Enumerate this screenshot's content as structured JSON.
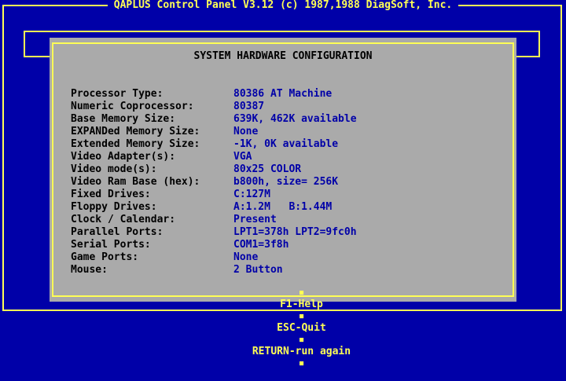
{
  "window": {
    "title": "QAPLUS Control Panel V3.12 (c) 1987,1988 DiagSoft, Inc."
  },
  "dialog": {
    "title": "SYSTEM HARDWARE CONFIGURATION",
    "rows": [
      {
        "label": "Processor Type:",
        "value": "80386 AT Machine"
      },
      {
        "label": "Numeric Coprocessor:",
        "value": "80387"
      },
      {
        "label": "Base Memory Size:",
        "value": "639K, 462K available"
      },
      {
        "label": "EXPANDed Memory Size:",
        "value": "None"
      },
      {
        "label": "Extended Memory Size:",
        "value": "-1K, 0K available"
      },
      {
        "label": "Video Adapter(s):",
        "value": "VGA"
      },
      {
        "label": "Video mode(s):",
        "value": "80x25 COLOR"
      },
      {
        "label": "Video Ram Base (hex):",
        "value": "b800h, size= 256K"
      },
      {
        "label": "Fixed Drives:",
        "value": "C:127M"
      },
      {
        "label": "Floppy Drives:",
        "value": "A:1.2M   B:1.44M"
      },
      {
        "label": "Clock / Calendar:",
        "value": "Present"
      },
      {
        "label": "Parallel Ports:",
        "value": "LPT1=378h LPT2=9fc0h"
      },
      {
        "label": "Serial Ports:",
        "value": "COM1=3f8h"
      },
      {
        "label": "Game Ports:",
        "value": "None"
      },
      {
        "label": "Mouse:",
        "value": "2 Button"
      }
    ]
  },
  "footer": {
    "bullet": "▪",
    "f1_label": "F1-Help",
    "esc_label": "ESC-Quit",
    "return_label": "RETURN-run again"
  },
  "colors": {
    "background": "#0000a8",
    "panel": "#aaaaaa",
    "frame": "#ffff55",
    "label_text": "#000000",
    "value_text": "#0000a8"
  }
}
